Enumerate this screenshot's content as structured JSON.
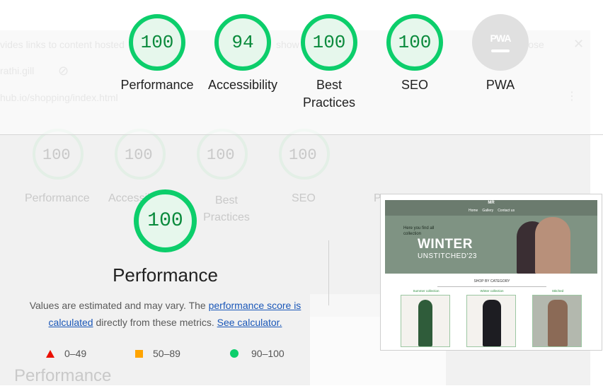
{
  "colors": {
    "pass": "#0cce6b",
    "pass_text": "#0a8a3c",
    "average": "#ffa400",
    "fail": "#eb0f00",
    "link": "#1a57b8",
    "pwa_gray": "#e0e0e0"
  },
  "ghost": {
    "banner_text": "vides links to content hosted",
    "banner_text2": "show",
    "close_text": "Close",
    "user_text": "rathi.gill",
    "url_text": "hub.io/shopping/index.html",
    "labels": [
      "Performance",
      "Accessibility",
      "Best Practices",
      "SEO",
      "PWA"
    ],
    "scores": [
      "100",
      "100",
      "100",
      "100"
    ],
    "bottom_heading": "Performance"
  },
  "summary": [
    {
      "id": "performance",
      "score": "100",
      "label": "Performance"
    },
    {
      "id": "accessibility",
      "score": "94",
      "label": "Accessibility"
    },
    {
      "id": "best-practices",
      "score": "100",
      "label": "Best Practices"
    },
    {
      "id": "seo",
      "score": "100",
      "label": "SEO"
    },
    {
      "id": "pwa",
      "badge": "PWA",
      "label": "PWA"
    }
  ],
  "performance": {
    "score": "100",
    "title": "Performance",
    "desc_prefix": "Values are estimated and may vary. The ",
    "link_score": "performance score is calculated",
    "desc_middle": " directly from these metrics. ",
    "link_calc": "See calculator."
  },
  "legend": [
    {
      "shape": "triangle",
      "range": "0–49"
    },
    {
      "shape": "square",
      "range": "50–89"
    },
    {
      "shape": "circle",
      "range": "90–100"
    }
  ],
  "screenshot": {
    "logo": "MR",
    "nav": [
      "Home",
      "Gallery",
      "Contact us"
    ],
    "hero_small": "Here you find all collection",
    "hero_title": "WINTER",
    "hero_sub": "UNSTITCHED'23",
    "shop_heading": "SHOP BY CATEGORY",
    "categories": [
      "Summer collection",
      "Winter collection",
      "Stitched"
    ]
  }
}
